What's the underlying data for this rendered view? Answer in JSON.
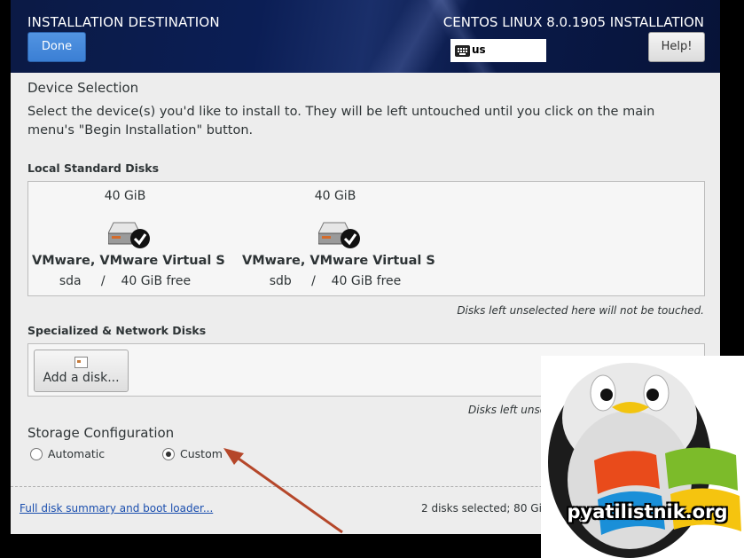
{
  "header": {
    "title": "INSTALLATION DESTINATION",
    "product": "CENTOS LINUX 8.0.1905 INSTALLATION",
    "done_label": "Done",
    "keyboard_layout": "us",
    "help_label": "Help!",
    "bg_color": "#0b1e55",
    "done_color": "#3b7fd4"
  },
  "device_selection": {
    "title": "Device Selection",
    "description": "Select the device(s) you'd like to install to.  They will be left untouched until you click on the main menu's \"Begin Installation\" button."
  },
  "local_disks": {
    "title": "Local Standard Disks",
    "note": "Disks left unselected here will not be touched.",
    "disks": [
      {
        "size": "40 GiB",
        "name": "VMware, VMware Virtual S",
        "device": "sda",
        "sep": "/",
        "free": "40 GiB free",
        "icon": "harddisk-checked-icon"
      },
      {
        "size": "40 GiB",
        "name": "VMware, VMware Virtual S",
        "device": "sdb",
        "sep": "/",
        "free": "40 GiB free",
        "icon": "harddisk-checked-icon"
      }
    ]
  },
  "network_disks": {
    "title": "Specialized & Network Disks",
    "add_disk_label": "Add a disk...",
    "note": "Disks left unse"
  },
  "storage_config": {
    "title": "Storage Configuration",
    "options": [
      {
        "label": "Automatic",
        "selected": false
      },
      {
        "label": "Custom",
        "selected": true
      }
    ]
  },
  "footer": {
    "link": "Full disk summary and boot loader...",
    "summary": "2 disks selected; 80 GiB"
  },
  "watermark": {
    "text": "pyatilistnik.org"
  },
  "annotation": {
    "arrow_color": "#b5472a"
  }
}
